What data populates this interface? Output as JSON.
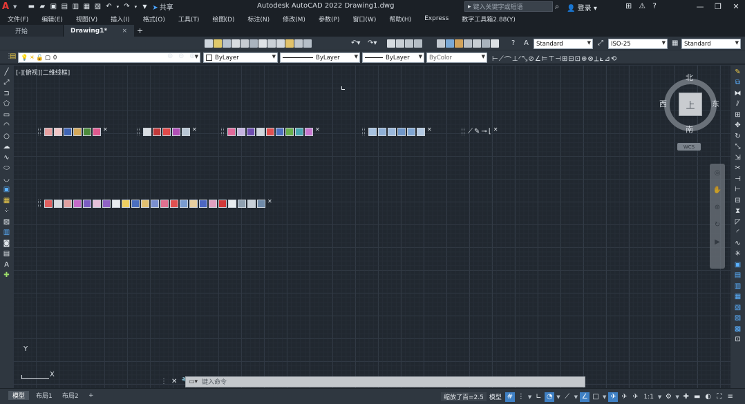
{
  "window": {
    "title": "Autodesk AutoCAD 2022    Drawing1.dwg",
    "app_logo": "A",
    "share_label": "共享",
    "search_placeholder": "键入关键字或短语",
    "user_label": "登录",
    "controls": [
      "minimize-icon",
      "restore-icon",
      "close-icon"
    ]
  },
  "menu": [
    "文件(F)",
    "编辑(E)",
    "视图(V)",
    "插入(I)",
    "格式(O)",
    "工具(T)",
    "绘图(D)",
    "标注(N)",
    "修改(M)",
    "参数(P)",
    "窗口(W)",
    "帮助(H)",
    "Express",
    "数字工具箱2.88(Y)"
  ],
  "tabs": {
    "start": "开始",
    "active": "Drawing1*",
    "close": "×",
    "add": "+"
  },
  "toolbar_styles": {
    "text_style": "Standard",
    "dim_style": "ISO-25",
    "table_style": "Standard"
  },
  "layer_toolbar": {
    "layer": "0",
    "color": "ByLayer",
    "linetype": "ByLayer",
    "lineweight": "ByLayer",
    "plotstyle": "ByColor"
  },
  "viewport_label": "[-][俯视][二维线框]",
  "viewcube": {
    "north": "北",
    "south": "南",
    "east": "东",
    "west": "西",
    "face": "上",
    "wcs": "WCS"
  },
  "ucs": {
    "x": "X",
    "y": "Y"
  },
  "command_line": {
    "placeholder": "键入命令"
  },
  "layout_tabs": [
    "模型",
    "布局1",
    "布局2"
  ],
  "layout_add": "+",
  "status": {
    "scale_readout": "缩放了百=2.5",
    "model_label": "模型",
    "annot_scale": "1:1"
  },
  "colors": {
    "background": "#212830",
    "panel": "#2f3740",
    "titlebar": "#1b2026",
    "accent": "#3f80c4"
  }
}
